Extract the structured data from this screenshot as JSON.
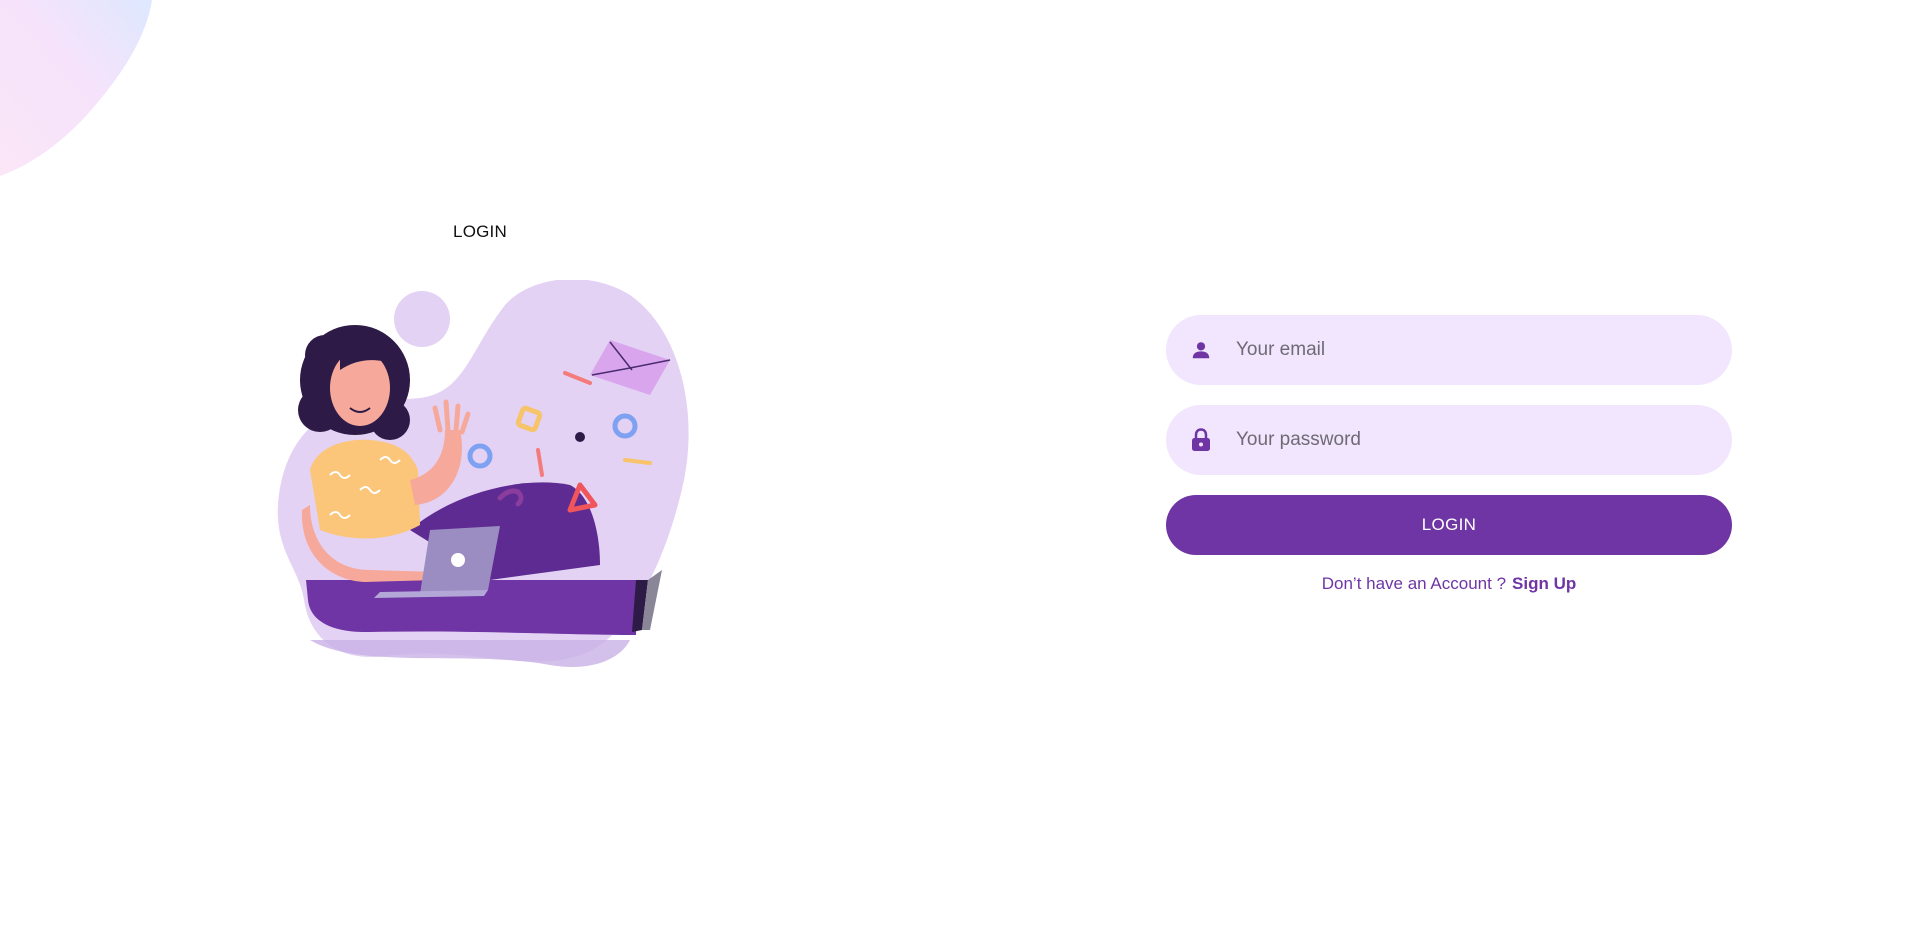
{
  "page": {
    "heading": "LOGIN"
  },
  "form": {
    "email": {
      "placeholder": "Your email",
      "value": "",
      "icon": "user-icon"
    },
    "password": {
      "placeholder": "Your password",
      "value": "",
      "icon": "lock-icon"
    },
    "submit_label": "LOGIN",
    "signup_prompt": "Don’t have an Account ?",
    "signup_link": "Sign Up"
  },
  "colors": {
    "accent": "#6f35a5",
    "field_background": "#f1e6fd",
    "illustration_blob": "#e3d2f4"
  }
}
